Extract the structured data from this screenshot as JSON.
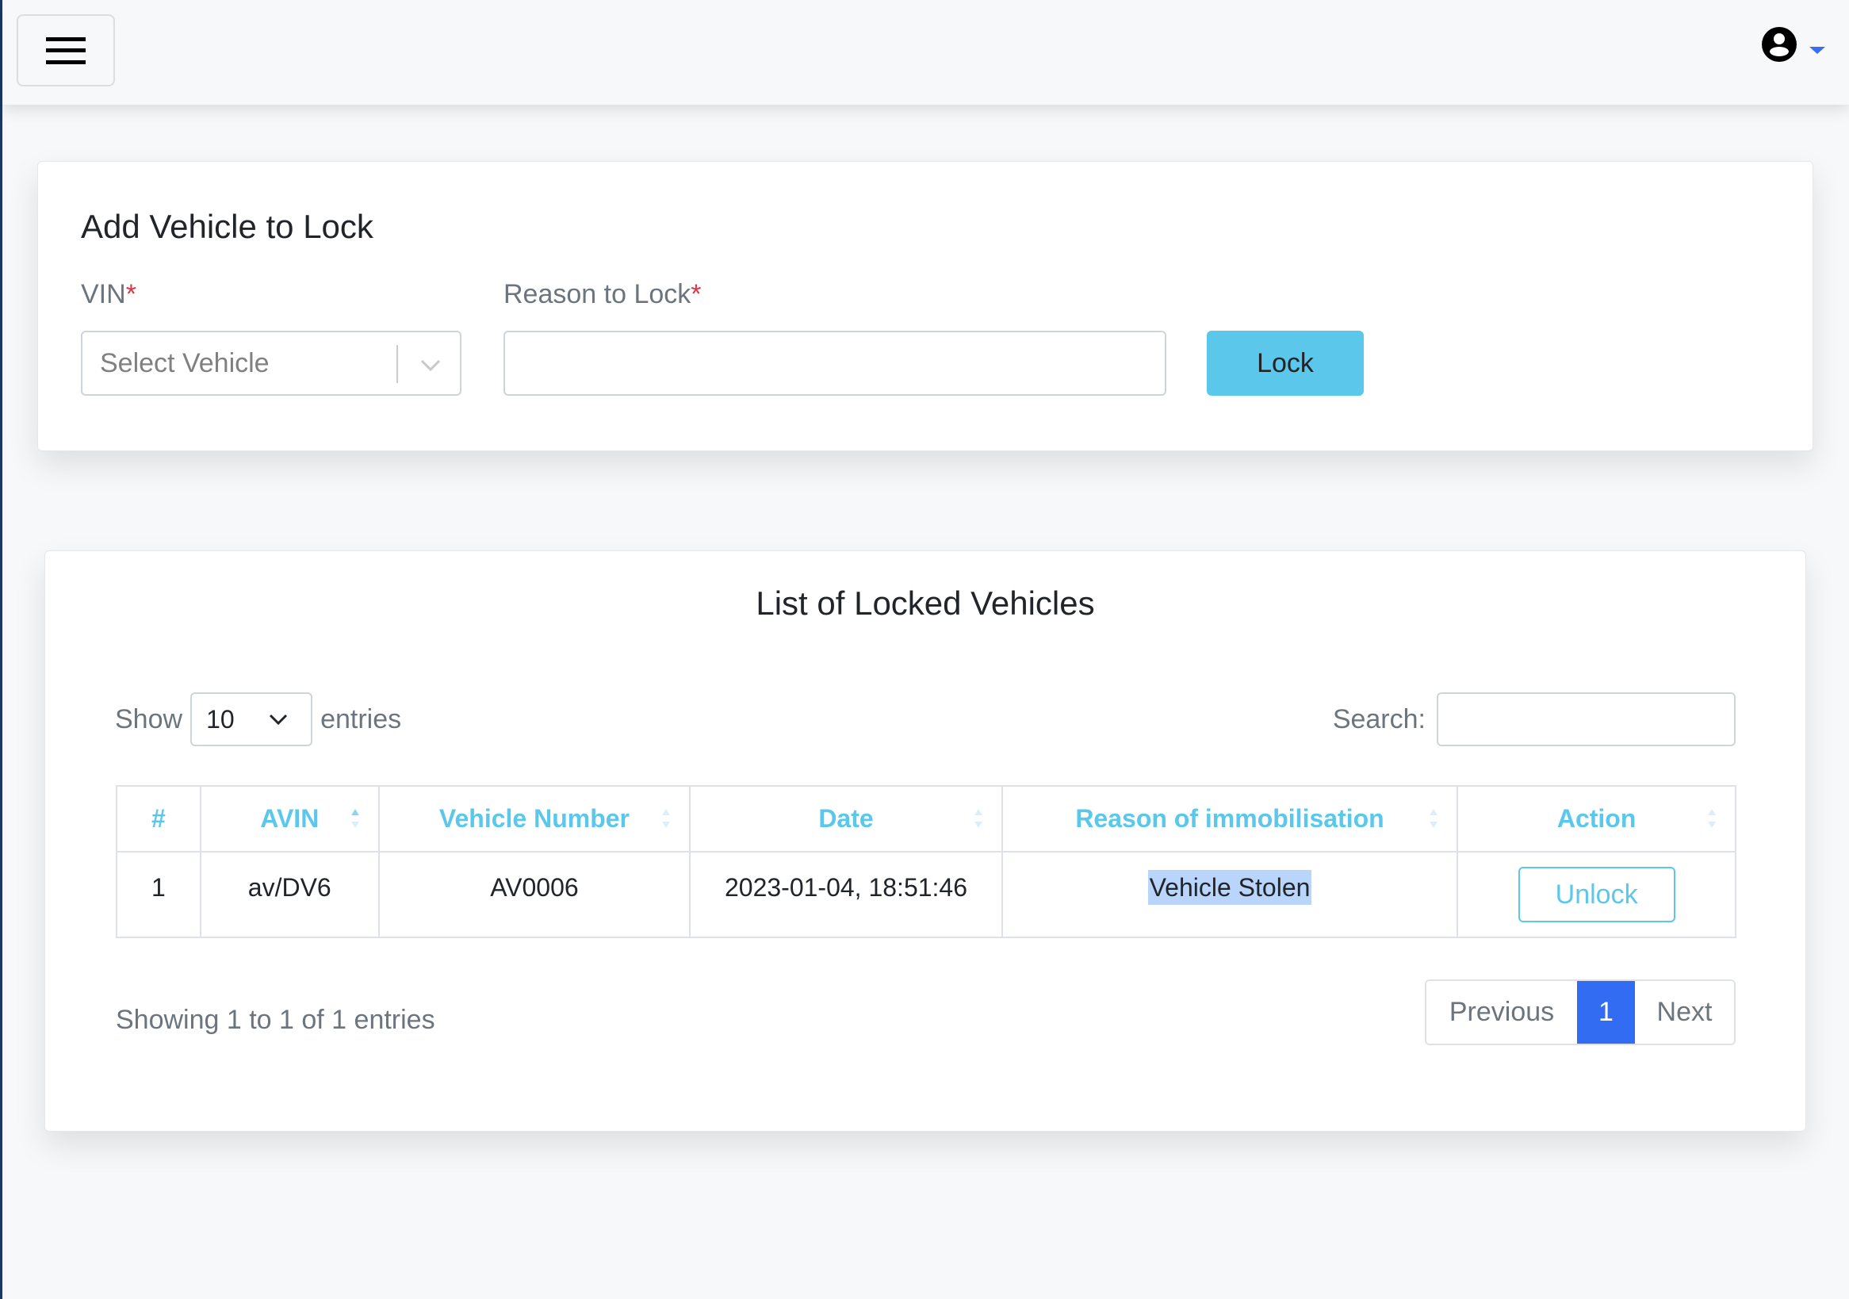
{
  "topbar": {
    "menu_icon": "hamburger-icon",
    "user_icon": "user-circle-icon",
    "dropdown_icon": "caret-down-icon",
    "accent_color": "#3a6cf4"
  },
  "add_form": {
    "title": "Add Vehicle to Lock",
    "vin_label": "VIN",
    "reason_label": "Reason to Lock",
    "required_marker": "*",
    "vin_placeholder": "Select Vehicle",
    "reason_value": "",
    "lock_button": "Lock",
    "lock_button_color": "#5bc7eb"
  },
  "list": {
    "title": "List of Locked Vehicles",
    "show_label": "Show",
    "entries_label": "entries",
    "page_length": "10",
    "search_label": "Search:",
    "search_value": "",
    "columns": [
      "#",
      "AVIN",
      "Vehicle Number",
      "Date",
      "Reason of immobilisation",
      "Action"
    ],
    "rows": [
      {
        "index": "1",
        "avin": "av/DV6",
        "vehicle_number": "AV0006",
        "date": "2023-01-04, 18:51:46",
        "reason": "Vehicle Stolen",
        "action": "Unlock"
      }
    ],
    "info": "Showing 1 to 1 of 1 entries",
    "pagination": {
      "previous": "Previous",
      "current_page": "1",
      "next": "Next",
      "active_color": "#326cf2"
    }
  }
}
